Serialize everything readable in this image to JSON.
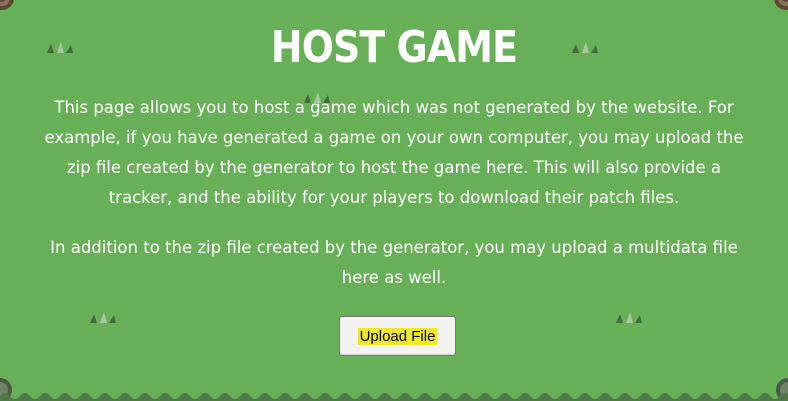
{
  "page": {
    "title": "HOST GAME",
    "description_1": "This page allows you to host a game which was not generated by the website. For example, if you have generated a game on your own computer, you may upload the zip file created by the generator to host the game here. This will also provide a tracker, and the ability for your players to download their patch files.",
    "description_2": "In addition to the zip file created by the generator, you may upload a multidata file here as well.",
    "upload_button_label": "Upload File"
  },
  "theme": {
    "background": "#68b057",
    "text_color": "#ffffff",
    "highlight": "#f0e82a",
    "decor_dark": "#3f6e3a",
    "decor_light": "#a7c9a0"
  },
  "decorations": {
    "grass_icon": "grass-tuft-icon",
    "corner_icon": "tree-stump-icon",
    "border_icon": "wavy-border-icon"
  }
}
